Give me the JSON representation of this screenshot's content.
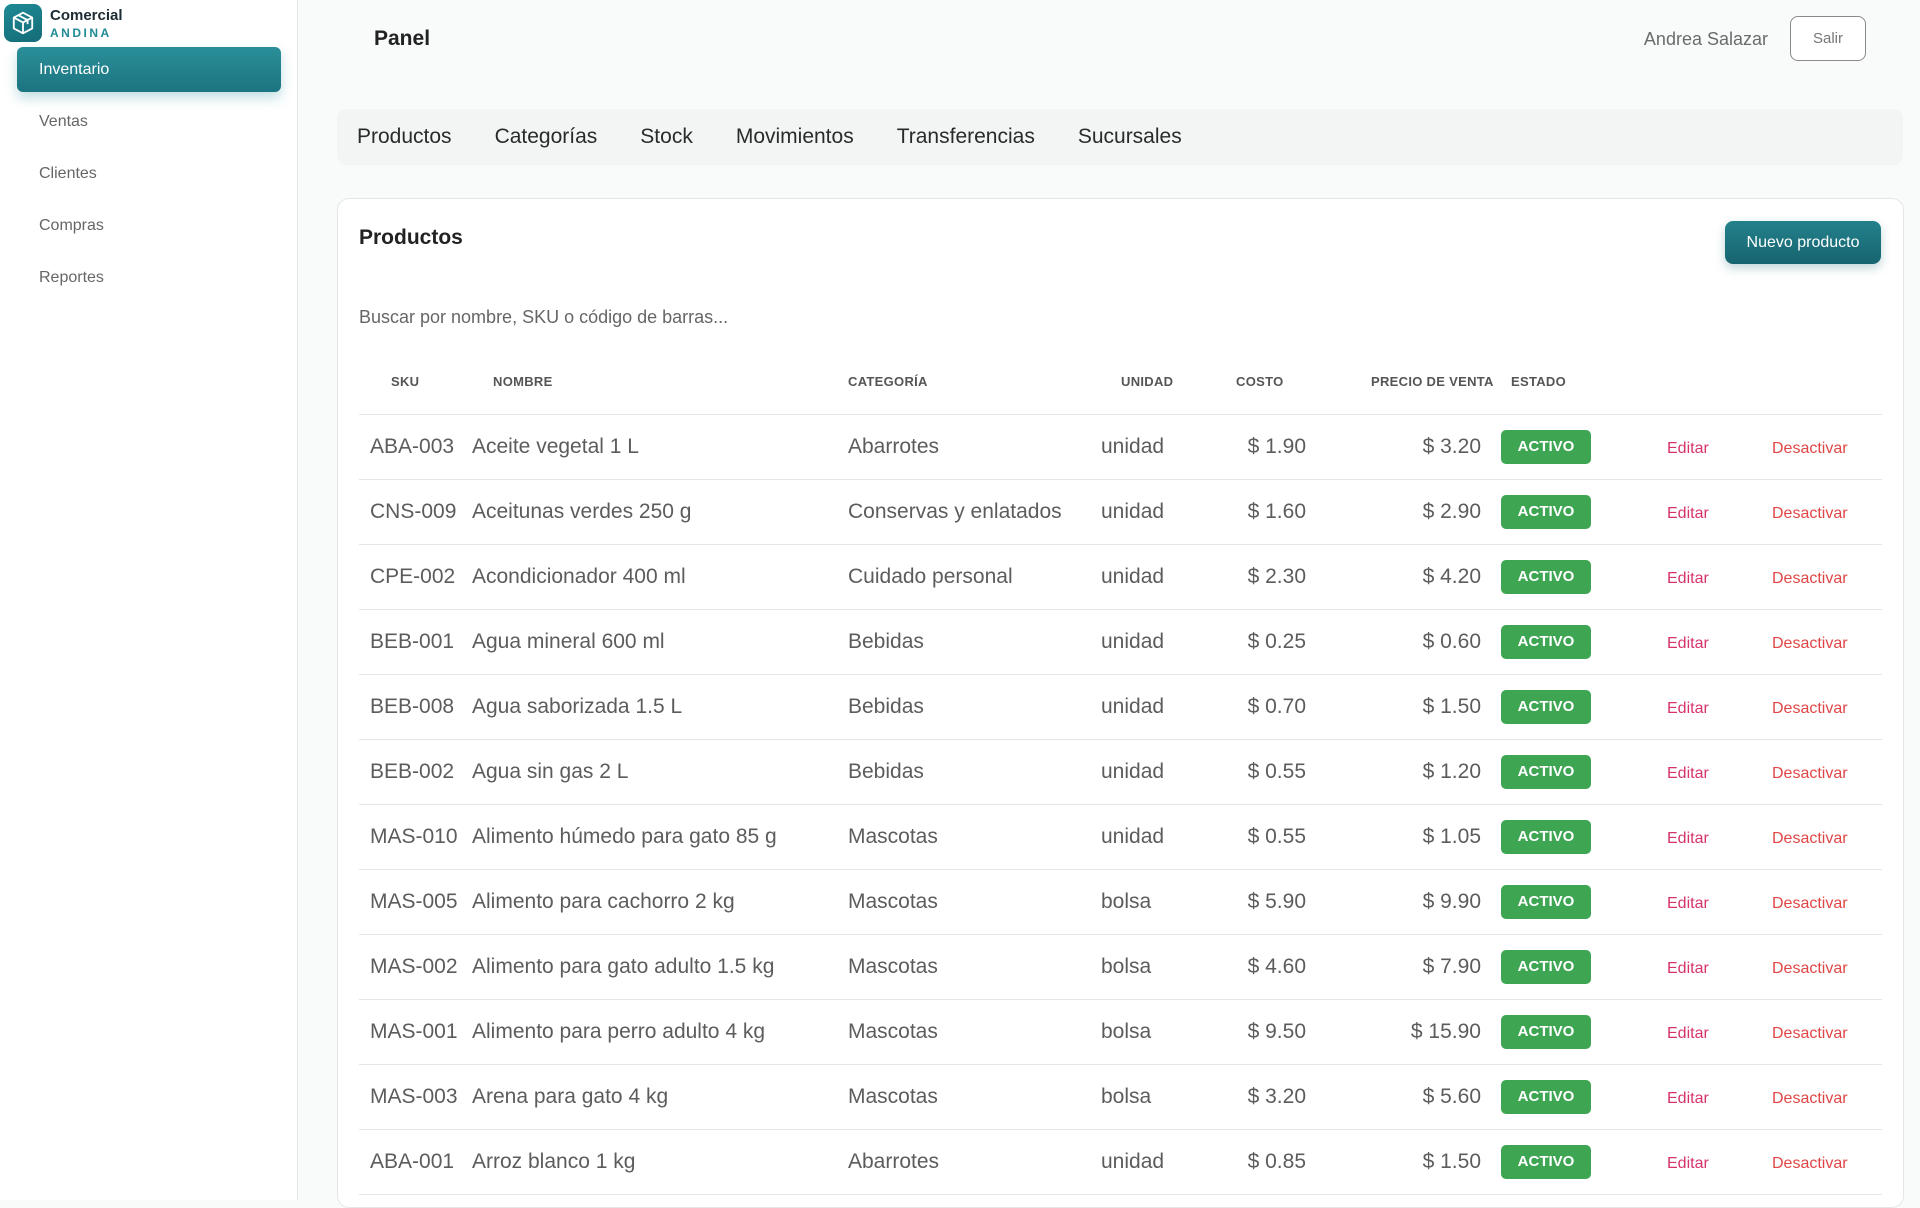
{
  "brand": {
    "name": "Comercial",
    "sub": "ANDINA"
  },
  "sidebar": {
    "items": [
      {
        "label": "Inventario",
        "active": true
      },
      {
        "label": "Ventas",
        "active": false
      },
      {
        "label": "Clientes",
        "active": false
      },
      {
        "label": "Compras",
        "active": false
      },
      {
        "label": "Reportes",
        "active": false
      }
    ]
  },
  "header": {
    "title": "Panel",
    "user": "Andrea Salazar",
    "logout_label": "Salir"
  },
  "tabs": [
    "Productos",
    "Categorías",
    "Stock",
    "Movimientos",
    "Transferencias",
    "Sucursales"
  ],
  "card": {
    "title": "Productos",
    "new_button": "Nuevo producto",
    "search_placeholder": "Buscar por nombre, SKU o código de barras...",
    "columns": [
      "SKU",
      "NOMBRE",
      "CATEGORÍA",
      "UNIDAD",
      "COSTO",
      "PRECIO DE VENTA",
      "ESTADO"
    ],
    "edit_label": "Editar",
    "deactivate_label": "Desactivar",
    "rows": [
      {
        "sku": "ABA-003",
        "name": "Aceite vegetal 1 L",
        "category": "Abarrotes",
        "unit": "unidad",
        "cost": "$ 1.90",
        "price": "$ 3.20",
        "status": "ACTIVO"
      },
      {
        "sku": "CNS-009",
        "name": "Aceitunas verdes 250 g",
        "category": "Conservas y enlatados",
        "unit": "unidad",
        "cost": "$ 1.60",
        "price": "$ 2.90",
        "status": "ACTIVO"
      },
      {
        "sku": "CPE-002",
        "name": "Acondicionador 400 ml",
        "category": "Cuidado personal",
        "unit": "unidad",
        "cost": "$ 2.30",
        "price": "$ 4.20",
        "status": "ACTIVO"
      },
      {
        "sku": "BEB-001",
        "name": "Agua mineral 600 ml",
        "category": "Bebidas",
        "unit": "unidad",
        "cost": "$ 0.25",
        "price": "$ 0.60",
        "status": "ACTIVO"
      },
      {
        "sku": "BEB-008",
        "name": "Agua saborizada 1.5 L",
        "category": "Bebidas",
        "unit": "unidad",
        "cost": "$ 0.70",
        "price": "$ 1.50",
        "status": "ACTIVO"
      },
      {
        "sku": "BEB-002",
        "name": "Agua sin gas 2 L",
        "category": "Bebidas",
        "unit": "unidad",
        "cost": "$ 0.55",
        "price": "$ 1.20",
        "status": "ACTIVO"
      },
      {
        "sku": "MAS-010",
        "name": "Alimento húmedo para gato 85 g",
        "category": "Mascotas",
        "unit": "unidad",
        "cost": "$ 0.55",
        "price": "$ 1.05",
        "status": "ACTIVO"
      },
      {
        "sku": "MAS-005",
        "name": "Alimento para cachorro 2 kg",
        "category": "Mascotas",
        "unit": "bolsa",
        "cost": "$ 5.90",
        "price": "$ 9.90",
        "status": "ACTIVO"
      },
      {
        "sku": "MAS-002",
        "name": "Alimento para gato adulto 1.5 kg",
        "category": "Mascotas",
        "unit": "bolsa",
        "cost": "$ 4.60",
        "price": "$ 7.90",
        "status": "ACTIVO"
      },
      {
        "sku": "MAS-001",
        "name": "Alimento para perro adulto 4 kg",
        "category": "Mascotas",
        "unit": "bolsa",
        "cost": "$ 9.50",
        "price": "$ 15.90",
        "status": "ACTIVO"
      },
      {
        "sku": "MAS-003",
        "name": "Arena para gato 4 kg",
        "category": "Mascotas",
        "unit": "bolsa",
        "cost": "$ 3.20",
        "price": "$ 5.60",
        "status": "ACTIVO"
      },
      {
        "sku": "ABA-001",
        "name": "Arroz blanco 1 kg",
        "category": "Abarrotes",
        "unit": "unidad",
        "cost": "$ 0.85",
        "price": "$ 1.50",
        "status": "ACTIVO"
      }
    ]
  },
  "colors": {
    "accent": "#1f8a96",
    "active_badge": "#3ea553",
    "edit_link": "#d6336c",
    "deactivate_link": "#e04646"
  },
  "icons": {
    "brand": "box-icon"
  }
}
